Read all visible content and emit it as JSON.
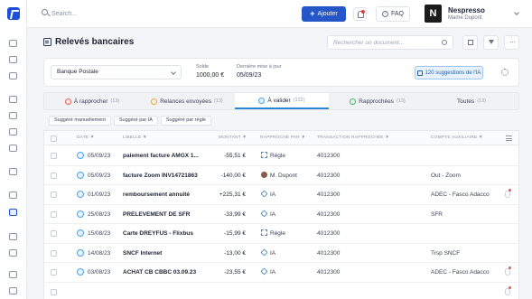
{
  "topbar": {
    "search_placeholder": "Search...",
    "add_label": "Ajouter",
    "faq_label": "FAQ",
    "company_initial": "N",
    "company_name": "Nespresso",
    "company_user": "Mame Dupont"
  },
  "page": {
    "title": "Relevés bancaires",
    "doc_search_placeholder": "Rechercher un document..."
  },
  "account": {
    "bank": "Banque Postale",
    "balance_label": "Solde",
    "balance_value": "1000,00 €",
    "last_update_label": "Dernière mise à jour",
    "last_update_value": "05/09/23",
    "suggestions_label": "120 suggestions de l'IA"
  },
  "tabs": [
    {
      "label": "À rapprocher",
      "count": "(13)",
      "color": "#e8605a"
    },
    {
      "label": "Relances envoyées",
      "count": "(13)",
      "color": "#f0a43a"
    },
    {
      "label": "À valider",
      "count": "(132)",
      "color": "#4aa3e8"
    },
    {
      "label": "Rapprochées",
      "count": "(13)",
      "color": "#4cb26a"
    },
    {
      "label": "Toutes",
      "count": "(13)",
      "color": ""
    }
  ],
  "sub_filters": [
    "Suggéré manuellement",
    "Suggéré par IA",
    "Suggéré par règle"
  ],
  "columns": {
    "date": "DATE ▼",
    "libelle": "LIBELLÉ ▼",
    "montant": "MONTANT ▼",
    "rapproche_par": "RAPPROCHÉ PAR ▼",
    "transaction": "TRANSACTION RAPPROCHÉE ▼",
    "compte": "COMPTE AUXILIAIRE ▼"
  },
  "rows": [
    {
      "date": "05/09/23",
      "label": "paiement facture AMGX 1...",
      "amount": "-55,51 €",
      "type": "Règle",
      "type_icon": "rule-icon",
      "txn": "4012300",
      "aux": "",
      "attach": false
    },
    {
      "date": "05/09/23",
      "label": "facture Zoom INV14721863",
      "amount": "-140,00 €",
      "type": "M. Dupont",
      "type_icon": "user-avatar",
      "txn": "4012300",
      "aux": "Out - Zoom",
      "attach": false
    },
    {
      "date": "01/09/23",
      "label": "remboursement annuité",
      "amount": "+225,31 €",
      "type": "IA",
      "type_icon": "ia-icon",
      "txn": "4012300",
      "aux": "ADEC - Fasco Adacco",
      "attach": true
    },
    {
      "date": "25/08/23",
      "label": "PRELEVEMENT DE SFR",
      "amount": "-33,99 €",
      "type": "IA",
      "type_icon": "ia-icon",
      "txn": "4012300",
      "aux": "SFR",
      "attach": false
    },
    {
      "date": "15/08/23",
      "label": "Carte DREYFUS - Flixbus",
      "amount": "-15,99 €",
      "type": "Règle",
      "type_icon": "rule-icon",
      "txn": "4012300",
      "aux": "",
      "attach": false
    },
    {
      "date": "14/08/23",
      "label": "SNCF Internet",
      "amount": "-13,00 €",
      "type": "IA",
      "type_icon": "ia-icon",
      "txn": "4012300",
      "aux": "Trsp SNCF",
      "attach": false
    },
    {
      "date": "03/08/23",
      "label": "ACHAT CB CBBC 03.09.23",
      "amount": "-23,55 €",
      "type": "IA",
      "type_icon": "ia-icon",
      "txn": "4012300",
      "aux": "ADEC - Fasco Adacco",
      "attach": true
    },
    {
      "date": "",
      "label": "",
      "amount": "",
      "type": "",
      "type_icon": "",
      "txn": "",
      "aux": "",
      "attach": true
    }
  ]
}
